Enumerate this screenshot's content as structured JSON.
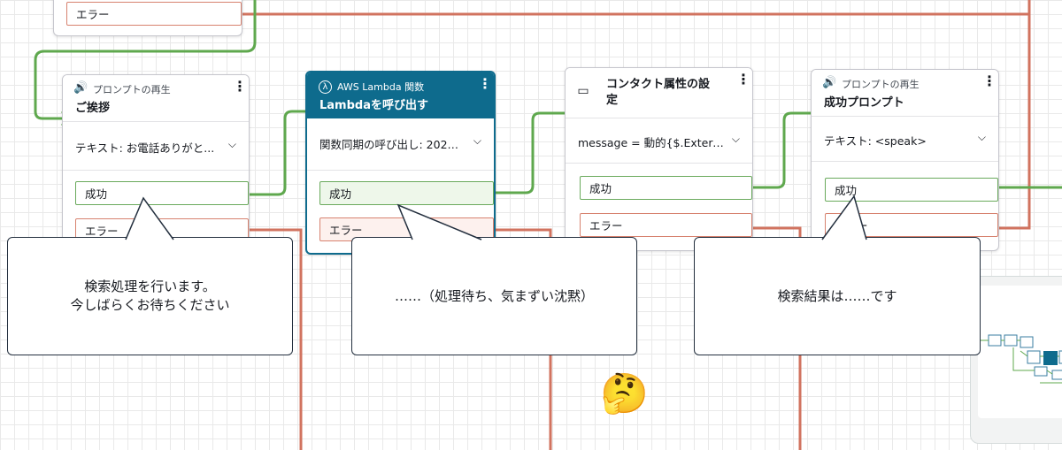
{
  "top_block": {
    "error_label": "エラー"
  },
  "blocks": [
    {
      "type": "プロンプトの再生",
      "title": "ご挨拶",
      "setting": "テキスト: お電話ありがと...",
      "success": "成功",
      "error": "エラー",
      "icon": "speaker-icon"
    },
    {
      "type": "AWS Lambda 関数",
      "title": "Lambdaを呼び出す",
      "setting": "関数同期の呼び出し: 2025...",
      "success": "成功",
      "error": "エラー",
      "icon": "lambda-icon"
    },
    {
      "type": "",
      "title": "コンタクト属性の設定",
      "setting": "message = 動的{$.Externa...",
      "success": "成功",
      "error": "エラー",
      "icon": "contact-attribute-icon"
    },
    {
      "type": "プロンプトの再生",
      "title": "成功プロンプト",
      "setting": "テキスト: <speak>",
      "success": "成功",
      "error": "エラー",
      "icon": "speaker-icon"
    }
  ],
  "bubbles": [
    {
      "line1": "検索処理を行います。",
      "line2": "今しばらくお待ちください"
    },
    {
      "line1": "……（処理待ち、気まずい沈黙）",
      "line2": ""
    },
    {
      "line1": "検索結果は……です",
      "line2": ""
    }
  ],
  "emoji": "🤔",
  "colors": {
    "success_wire": "#5fa84e",
    "error_wire": "#d1735f",
    "lambda_header": "#0e6b8d",
    "bubble_border": "#232f3e"
  }
}
